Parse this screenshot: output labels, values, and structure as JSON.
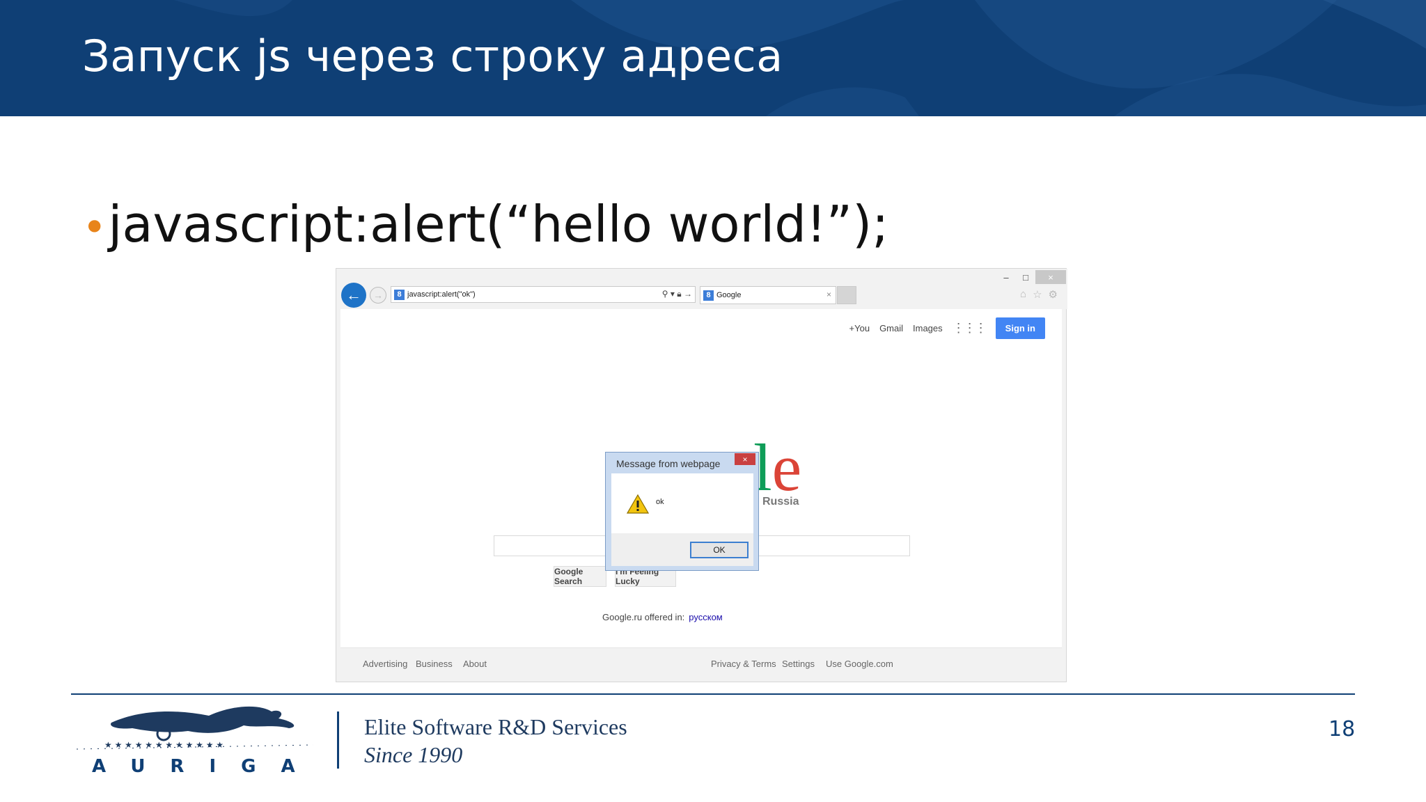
{
  "slide": {
    "title": "Запуск js через строку адреса",
    "bullet": "javascript:alert(“hello world!”);",
    "page_number": "18"
  },
  "colors": {
    "header": "#0f3f75",
    "bullet_dot": "#e8841a",
    "google_blue": "#4285f4"
  },
  "browser": {
    "address_value": "javascript:alert(\"ok\")",
    "tab_title": "Google",
    "window_buttons": [
      "–",
      "□",
      "×"
    ],
    "toolbar_icons": [
      "home-icon",
      "star-icon",
      "gear-icon"
    ],
    "google_bar": {
      "plus_you": "+You",
      "gmail": "Gmail",
      "images": "Images",
      "sign_in": "Sign in"
    },
    "logo_partial": "le",
    "logo_subtitle": "Russia",
    "search_button": "Google Search",
    "lucky_button": "I'm Feeling Lucky",
    "offered_text": "Google.ru offered in:",
    "offered_link": "русском",
    "footer_left": [
      "Advertising",
      "Business",
      "About"
    ],
    "footer_right": [
      "Privacy & Terms",
      "Settings",
      "Use Google.com"
    ]
  },
  "dialog": {
    "title": "Message from webpage",
    "message": "ok",
    "ok_label": "OK",
    "close": "×"
  },
  "brand": {
    "logo_text": "AURIGA",
    "tagline_1": "Elite Software R&D Services",
    "tagline_2": "Since 1990"
  }
}
